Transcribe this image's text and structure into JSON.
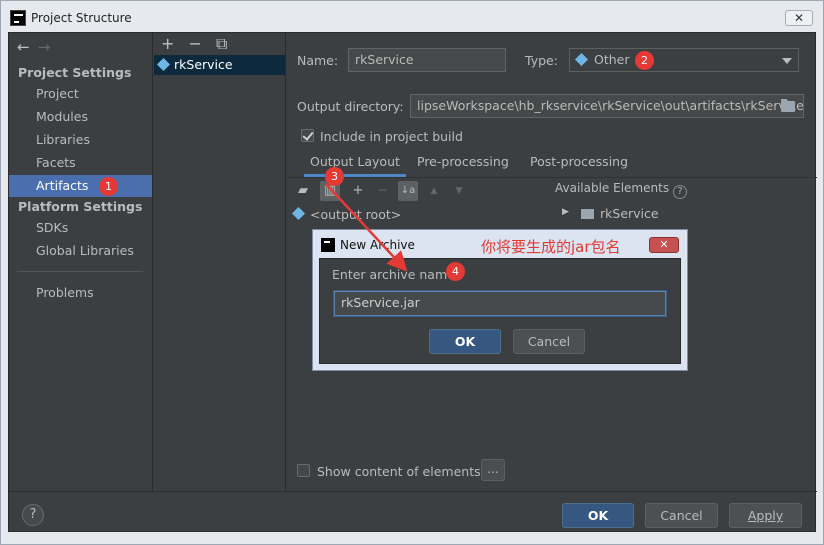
{
  "window": {
    "title": "Project Structure",
    "close_glyph": "✕"
  },
  "nav": {
    "back_glyph": "←",
    "forward_glyph": "→",
    "project_settings_header": "Project Settings",
    "project_items": [
      "Project",
      "Modules",
      "Libraries",
      "Facets",
      "Artifacts"
    ],
    "platform_settings_header": "Platform Settings",
    "platform_items": [
      "SDKs",
      "Global Libraries"
    ],
    "problems": "Problems",
    "selected": "Artifacts"
  },
  "artifacts": {
    "add_glyph": "+",
    "remove_glyph": "−",
    "copy_glyph": "⧉",
    "items": [
      "rkService"
    ]
  },
  "form": {
    "name_label": "Name:",
    "name_value": "rkService",
    "type_label": "Type:",
    "type_value": "Other",
    "output_dir_label": "Output directory:",
    "output_dir_value": "lipseWorkspace\\hb_rkservice\\rkService\\out\\artifacts\\rkService",
    "include_in_build_label": "Include in project build",
    "include_in_build_checked": true,
    "tabs": [
      "Output Layout",
      "Pre-processing",
      "Post-processing"
    ],
    "active_tab": "Output Layout",
    "layout_root": "<output root>",
    "available_elements_label": "Available Elements",
    "available_items": [
      "rkService"
    ],
    "show_content_label": "Show content of elements",
    "show_content_checked": false,
    "ellipsis_button": "..."
  },
  "toolbar": {
    "add_glyph": "+",
    "remove_glyph": "−",
    "sort_glyph": "↓a",
    "up_glyph": "▲",
    "down_glyph": "▼"
  },
  "bottom": {
    "help_glyph": "?",
    "ok": "OK",
    "cancel": "Cancel",
    "apply": "Apply"
  },
  "dialog": {
    "title": "New Archive",
    "close_glyph": "✕",
    "prompt_label": "Enter archive name:",
    "archive_name_value": "rkService.jar",
    "ok": "OK",
    "cancel": "Cancel",
    "annotation": "你将要生成的jar包名"
  },
  "badges": {
    "b1": "1",
    "b2": "2",
    "b3": "3",
    "b4": "4"
  },
  "colors": {
    "background": "#3c3f41",
    "selection": "#4b6eaf",
    "primary_button": "#365880",
    "annotation_red": "#e53935",
    "diamond_blue": "#6fb6e6"
  }
}
